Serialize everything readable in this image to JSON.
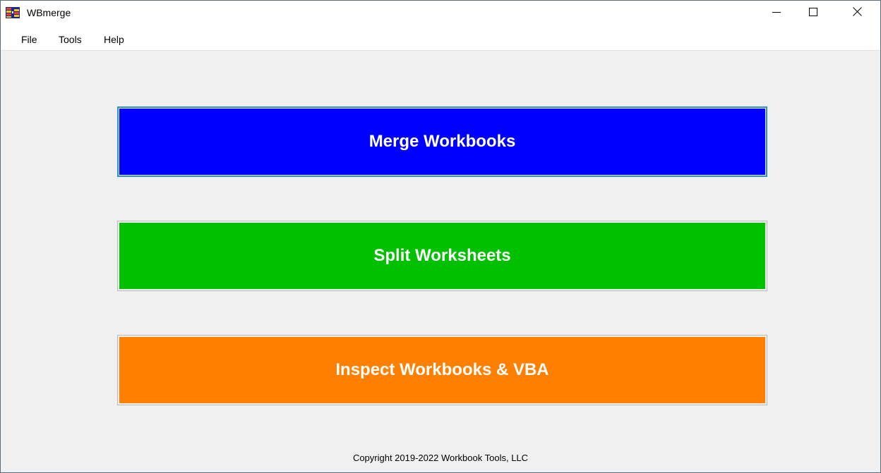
{
  "window": {
    "title": "WBmerge"
  },
  "menu": {
    "items": [
      {
        "label": "File"
      },
      {
        "label": "Tools"
      },
      {
        "label": "Help"
      }
    ]
  },
  "actions": [
    {
      "label": "Merge Workbooks",
      "color": "#0000ff",
      "focused": true
    },
    {
      "label": "Split Worksheets",
      "color": "#00c000",
      "focused": false
    },
    {
      "label": "Inspect Workbooks & VBA",
      "color": "#ff8000",
      "focused": false
    }
  ],
  "footer": {
    "copyright": "Copyright 2019-2022  Workbook Tools, LLC"
  },
  "icons": {
    "app": "wbmerge-app-icon",
    "minimize": "minimize-icon",
    "maximize": "maximize-icon",
    "close": "close-icon"
  }
}
